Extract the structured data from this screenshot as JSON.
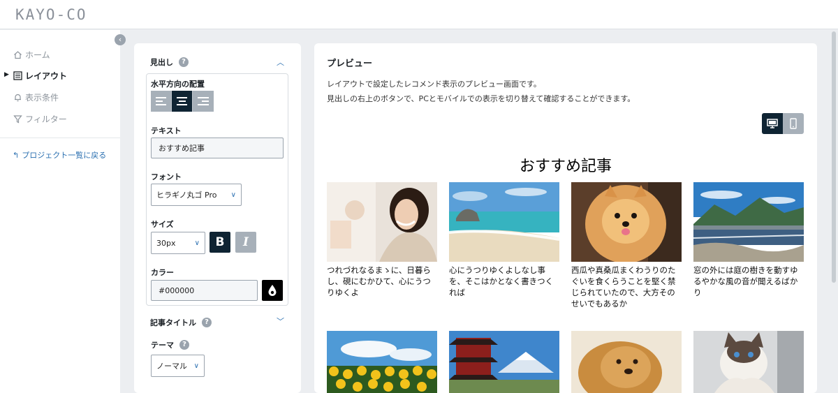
{
  "app": {
    "logo": "KAYO-CO"
  },
  "sidebar": {
    "items": [
      {
        "label": "ホーム",
        "icon": "home-icon"
      },
      {
        "label": "レイアウト",
        "icon": "layout-icon",
        "active": true
      },
      {
        "label": "表示条件",
        "icon": "bell-icon"
      },
      {
        "label": "フィルター",
        "icon": "filter-icon"
      }
    ],
    "back_link": "プロジェクト一覧に戻る"
  },
  "settings": {
    "heading_section": "見出し",
    "alignment_label": "水平方向の配置",
    "alignment_value": "center",
    "text_label": "テキスト",
    "text_value": "おすすめ記事",
    "font_label": "フォント",
    "font_value": "ヒラギノ丸ゴ Pro",
    "size_label": "サイズ",
    "size_value": "30px",
    "bold_label": "B",
    "italic_label": "I",
    "color_label": "カラー",
    "color_value": "#000000",
    "article_title_section": "記事タイトル",
    "theme_label": "テーマ",
    "theme_value": "ノーマル"
  },
  "preview": {
    "title": "プレビュー",
    "desc1": "レイアウトで設定したレコメンド表示のプレビュー画面です。",
    "desc2": "見出しの右上のボタンで、PCとモバイルでの表示を切り替えて確認することができます。",
    "device_selected": "pc",
    "recommend_heading": "おすすめ記事",
    "articles": [
      {
        "title": "つれづれなるまゝに、日暮らし、硯にむかひて、心にうつりゆくよ",
        "image": "woman-smiling"
      },
      {
        "title": "心にうつりゆくよしなし事を、そこはかとなく書きつくれば",
        "image": "beach"
      },
      {
        "title": "西瓜や真桑瓜まくわうりのたぐいを食くらうことを堅く禁じられていたので、大方そのせいでもあるか",
        "image": "pomeranian"
      },
      {
        "title": "窓の外には庭の樹きを動すゆるやかな風の音が聞えるばかり",
        "image": "mountain-lake"
      },
      {
        "title": "",
        "image": "sunflowers"
      },
      {
        "title": "",
        "image": "pagoda-fuji"
      },
      {
        "title": "",
        "image": "golden-retriever"
      },
      {
        "title": "",
        "image": "cat"
      }
    ]
  }
}
